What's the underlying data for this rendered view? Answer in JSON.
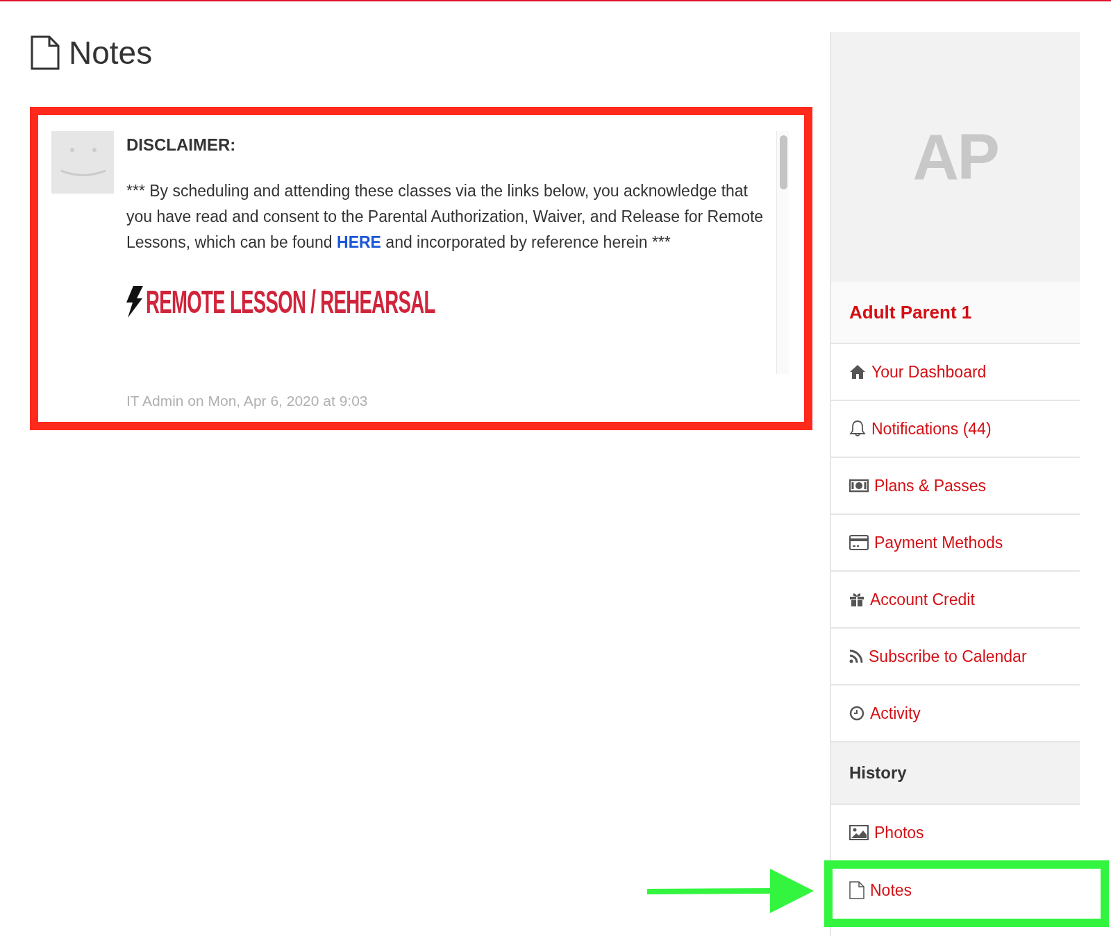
{
  "page": {
    "title": "Notes"
  },
  "notes": [
    {
      "heading": "DISCLAIMER:",
      "text_before": "*** By scheduling and attending these classes via the links below, you acknowledge that you have read and consent to the Parental Authorization, Waiver, and Release for Remote Lessons, which can be found",
      "link": "HERE",
      "text_after": "and incorporated by reference herein ***",
      "banner": "REMOTE LESSON / REHEARSAL",
      "meta": "IT Admin on Mon, Apr 6, 2020 at 9:03"
    }
  ],
  "sidebar": {
    "initials": "AP",
    "name": "Adult Parent 1",
    "items": [
      {
        "kind": "link",
        "label": "Your Dashboard"
      },
      {
        "kind": "link",
        "label": "Notifications (44)"
      },
      {
        "kind": "link",
        "label": "Plans & Passes"
      },
      {
        "kind": "link",
        "label": "Payment Methods"
      },
      {
        "kind": "link",
        "label": "Account Credit"
      },
      {
        "kind": "link",
        "label": "Subscribe to Calendar"
      },
      {
        "kind": "link",
        "label": "Activity"
      },
      {
        "kind": "header",
        "label": "History"
      },
      {
        "kind": "link",
        "label": "Photos"
      },
      {
        "kind": "link",
        "label": "Notes"
      }
    ]
  }
}
